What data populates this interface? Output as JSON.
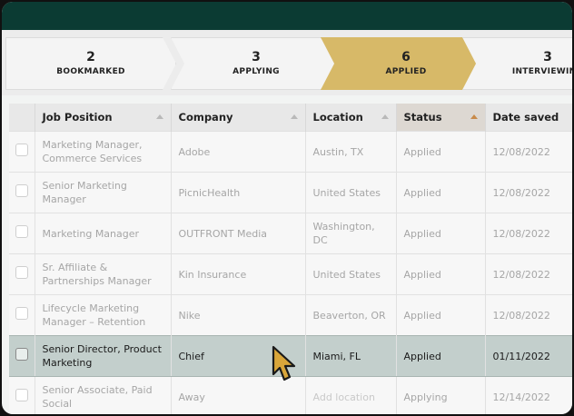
{
  "pipeline": [
    {
      "count": "2",
      "label": "BOOKMARKED"
    },
    {
      "count": "3",
      "label": "APPLYING"
    },
    {
      "count": "6",
      "label": "APPLIED"
    },
    {
      "count": "3",
      "label": "INTERVIEWING"
    }
  ],
  "table": {
    "headers": [
      "Job Position",
      "Company",
      "Location",
      "Status",
      "Date saved"
    ],
    "rows": [
      {
        "position": "Marketing Manager, Commerce Services",
        "company": "Adobe",
        "location": "Austin, TX",
        "status": "Applied",
        "date": "12/08/2022"
      },
      {
        "position": "Senior Marketing Manager",
        "company": "PicnicHealth",
        "location": "United States",
        "status": "Applied",
        "date": "12/08/2022"
      },
      {
        "position": "Marketing Manager",
        "company": "OUTFRONT Media",
        "location": "Washington, DC",
        "status": "Applied",
        "date": "12/08/2022"
      },
      {
        "position": "Sr. Affiliate & Partnerships Manager",
        "company": "Kin Insurance",
        "location": "United States",
        "status": "Applied",
        "date": "12/08/2022"
      },
      {
        "position": "Lifecycle Marketing Manager – Retention",
        "company": "Nike",
        "location": "Beaverton, OR",
        "status": "Applied",
        "date": "12/08/2022"
      },
      {
        "position": "Senior Director, Product Marketing",
        "company": "Chief",
        "location": "Miami, FL",
        "status": "Applied",
        "date": "01/11/2022"
      },
      {
        "position": "Senior Associate, Paid Social",
        "company": "Away",
        "location_placeholder": "Add location",
        "status": "Applying",
        "date": "12/14/2022"
      }
    ]
  },
  "colors": {
    "header_bar": "#0b3b33",
    "active_stage": "#d7b968",
    "highlight_row": "#c3cfcc",
    "cursor": "#d9a63a"
  },
  "cursor_icon": "pointer-cursor-icon"
}
